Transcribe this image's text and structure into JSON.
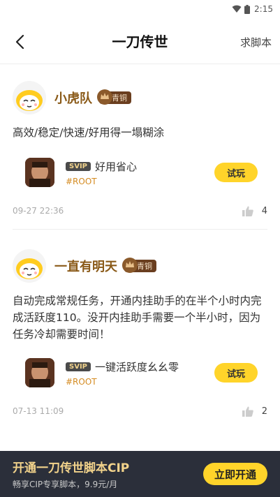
{
  "status_bar": {
    "time": "2:15"
  },
  "nav": {
    "title": "一刀传世",
    "right_label": "求脚本"
  },
  "posts": [
    {
      "username": "小虎队",
      "badge": "青铜",
      "content": "高效/稳定/快速/好用得一塌糊涂",
      "game": {
        "svip": "SVIP",
        "title": "好用省心",
        "tag": "#ROOT",
        "button": "试玩"
      },
      "date": "09-27 22:36",
      "likes": "4"
    },
    {
      "username": "一直有明天",
      "badge": "青铜",
      "content": "自动完成常规任务，开通内挂助手的在半个小时内完成活跃度110。没开内挂助手需要一个半小时，因为任务冷却需要时间！",
      "game": {
        "svip": "SVIP",
        "title": "一键活跃度幺幺零",
        "tag": "#ROOT",
        "button": "试玩"
      },
      "date": "07-13 11:09",
      "likes": "2"
    }
  ],
  "promo": {
    "title": "开通一刀传世脚本CIP",
    "subtitle": "畅享CIP专享脚本，9.9元/月",
    "button": "立即开通"
  }
}
